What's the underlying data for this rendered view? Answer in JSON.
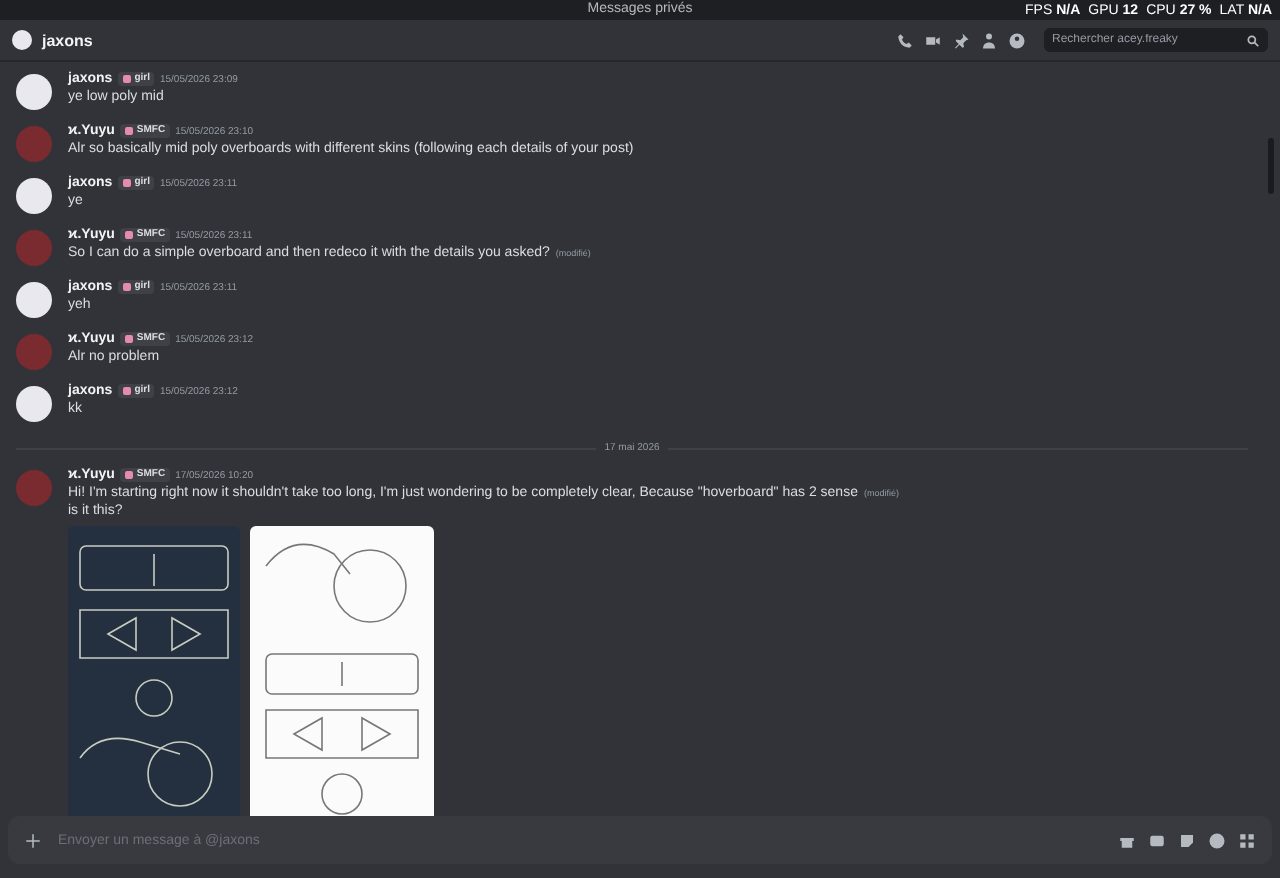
{
  "top_bar": {
    "title": "Messages privés",
    "stats": [
      {
        "label": "FPS",
        "value": "N/A"
      },
      {
        "label": "GPU",
        "value": "12"
      },
      {
        "label": "CPU",
        "value": "27 %"
      },
      {
        "label": "LAT",
        "value": "N/A"
      }
    ]
  },
  "header": {
    "channel": "jaxons",
    "search": {
      "placeholder": "Rechercher acey.freaky"
    }
  },
  "messages": [
    {
      "kind": "message",
      "author": "jaxons",
      "color": "#e8e8ee",
      "tag": "girl",
      "time": "15/05/2026 23:09",
      "text": "ye low poly mid"
    },
    {
      "kind": "message",
      "author": "ϰ.Yuyu",
      "color": "#7a2b2f",
      "tag": "SMFC",
      "time": "15/05/2026 23:10",
      "text": "Alr so basically mid poly overboards with different skins (following each details of your post)"
    },
    {
      "kind": "message",
      "author": "jaxons",
      "color": "#e8e8ee",
      "tag": "girl",
      "time": "15/05/2026 23:11",
      "text": "ye"
    },
    {
      "kind": "message",
      "author": "ϰ.Yuyu",
      "color": "#7a2b2f",
      "tag": "SMFC",
      "time": "15/05/2026 23:11",
      "text": "So I can do a simple overboard and then redeco it with the details you asked?",
      "edited": "(modifié)"
    },
    {
      "kind": "message",
      "author": "jaxons",
      "color": "#e8e8ee",
      "tag": "girl",
      "time": "15/05/2026 23:11",
      "text": "yeh"
    },
    {
      "kind": "message",
      "author": "ϰ.Yuyu",
      "color": "#7a2b2f",
      "tag": "SMFC",
      "time": "15/05/2026 23:12",
      "text": "Alr no problem"
    },
    {
      "kind": "message",
      "author": "jaxons",
      "color": "#e8e8ee",
      "tag": "girl",
      "time": "15/05/2026 23:12",
      "text": "kk"
    },
    {
      "kind": "divider",
      "text": "17 mai 2026"
    },
    {
      "kind": "images",
      "author": "ϰ.Yuyu",
      "color": "#7a2b2f",
      "tag": "SMFC",
      "time": "17/05/2026 10:20",
      "text": "Hi! I'm starting right now it shouldn't take too long, I'm just wondering to be completely clear, Because \"hoverboard\" has 2 sense",
      "edited": "(modifié)",
      "text2": "is it this?"
    }
  ],
  "composer": {
    "placeholder": "Envoyer un message à @jaxons"
  }
}
